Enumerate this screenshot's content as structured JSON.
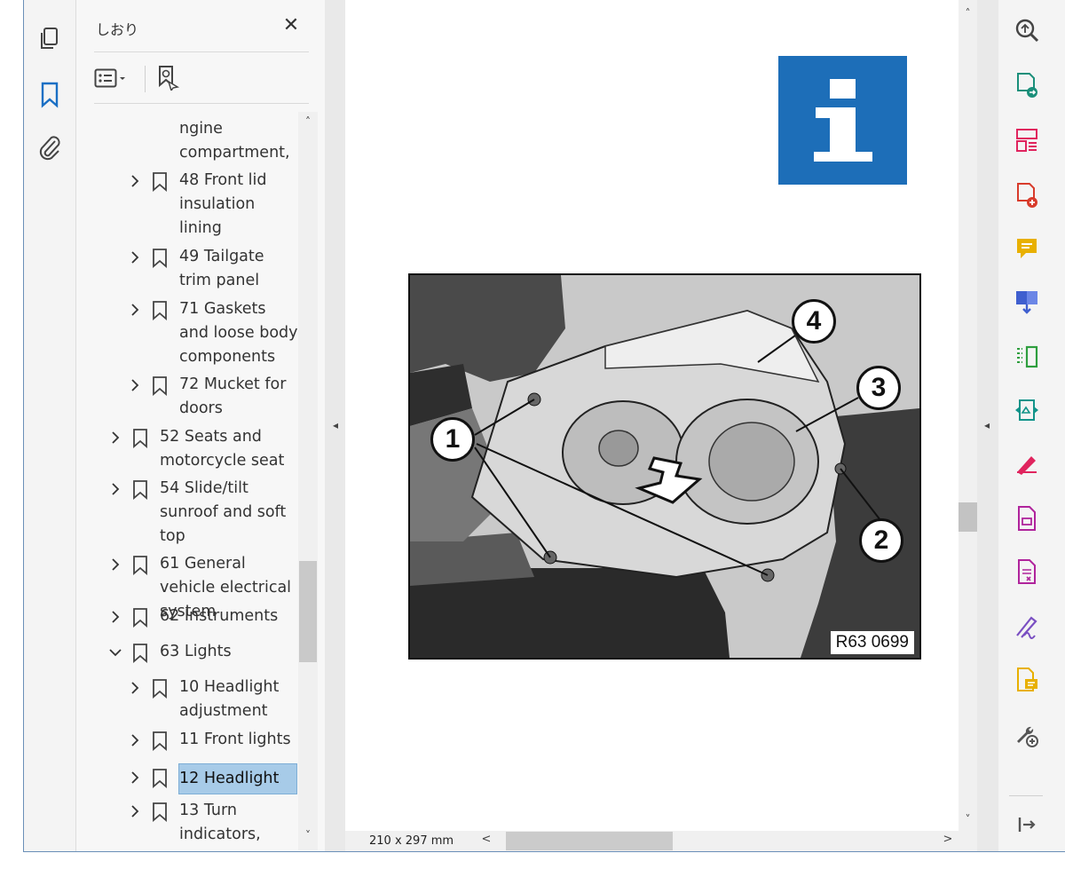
{
  "bookmarks_panel": {
    "title": "しおり",
    "close_label": "✕",
    "items": [
      {
        "label": "ngine compartment,",
        "level": 2,
        "has_children": false
      },
      {
        "label": "48 Front lid insulation lining",
        "level": 2,
        "has_children": true
      },
      {
        "label": "49 Tailgate trim panel",
        "level": 2,
        "has_children": true
      },
      {
        "label": "71 Gaskets and loose body components",
        "level": 2,
        "has_children": true
      },
      {
        "label": "72 Mucket for doors",
        "level": 2,
        "has_children": true
      },
      {
        "label": "52 Seats and motorcycle seat",
        "level": 1,
        "has_children": true
      },
      {
        "label": "54 Slide/tilt sunroof and soft top",
        "level": 1,
        "has_children": true
      },
      {
        "label": "61 General vehicle electrical system",
        "level": 1,
        "has_children": true
      },
      {
        "label": "62 Instruments",
        "level": 1,
        "has_children": true
      },
      {
        "label": "63 Lights",
        "level": 1,
        "has_children": true,
        "expanded": true
      },
      {
        "label": "10 Headlight adjustment",
        "level": 2,
        "has_children": true
      },
      {
        "label": "11 Front lights",
        "level": 2,
        "has_children": true
      },
      {
        "label": "12 Headlight",
        "level": 2,
        "has_children": true,
        "selected": true
      },
      {
        "label": "13 Turn indicators,",
        "level": 2,
        "has_children": true
      }
    ]
  },
  "document": {
    "figure_code": "R63 0699",
    "callouts": [
      "1",
      "2",
      "3",
      "4"
    ],
    "page_size": "210 x 297 mm"
  },
  "colors": {
    "info_blue": "#1d6eb8",
    "selection": "#a7cbe8",
    "bookmark_icon_active": "#1a6fc4"
  },
  "icons": {
    "left_rail": [
      "page-thumbnails-icon",
      "bookmarks-icon",
      "attachments-icon"
    ],
    "right_rail": [
      "zoom-icon",
      "export-pdf-icon",
      "organize-pages-icon",
      "create-pdf-icon",
      "comment-icon",
      "combine-files-icon",
      "compress-icon",
      "scan-ocr-icon",
      "fill-sign-icon",
      "edit-pdf-icon",
      "protect-icon",
      "request-signature-icon",
      "send-comments-icon",
      "more-tools-icon",
      "collapse-pane-icon"
    ]
  }
}
